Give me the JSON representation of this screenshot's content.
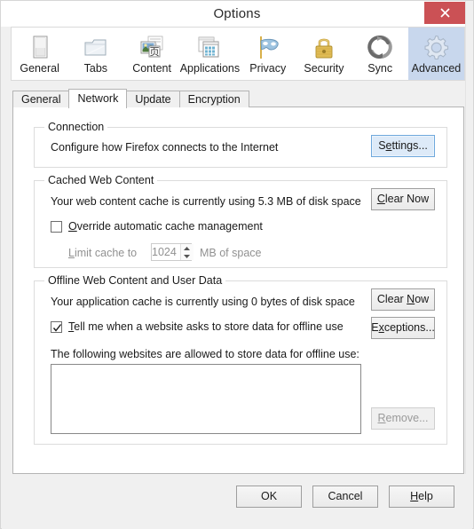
{
  "window": {
    "title": "Options",
    "close_label": "x",
    "close_icon": "close-icon"
  },
  "categories": [
    {
      "label": "General",
      "icon": "general-icon",
      "selected": false
    },
    {
      "label": "Tabs",
      "icon": "tabs-icon",
      "selected": false
    },
    {
      "label": "Content",
      "icon": "content-icon",
      "selected": false
    },
    {
      "label": "Applications",
      "icon": "applications-icon",
      "selected": false
    },
    {
      "label": "Privacy",
      "icon": "privacy-mask-icon",
      "selected": false
    },
    {
      "label": "Security",
      "icon": "padlock-icon",
      "selected": false
    },
    {
      "label": "Sync",
      "icon": "sync-arrows-icon",
      "selected": false
    },
    {
      "label": "Advanced",
      "icon": "gear-icon",
      "selected": true
    }
  ],
  "subtabs": [
    {
      "label": "General",
      "selected": false
    },
    {
      "label": "Network",
      "selected": true
    },
    {
      "label": "Update",
      "selected": false
    },
    {
      "label": "Encryption",
      "selected": false
    }
  ],
  "connection": {
    "group_title": "Connection",
    "description": "Configure how Firefox connects to the Internet",
    "settings_button": {
      "pre": "S",
      "accel": "e",
      "post": "ttings...",
      "focused": true
    }
  },
  "cache": {
    "group_title": "Cached Web Content",
    "usage_text": "Your web content cache is currently using 5.3 MB of disk space",
    "clear_button": {
      "pre": "",
      "accel": "C",
      "post": "lear Now"
    },
    "override_checkbox": {
      "checked": false,
      "pre": "",
      "accel": "O",
      "post": "verride automatic cache management"
    },
    "limit_label": {
      "pre": "",
      "accel": "L",
      "post": "imit cache to"
    },
    "limit_value": "1024",
    "limit_units": "MB of space",
    "disabled": true
  },
  "offline": {
    "group_title": "Offline Web Content and User Data",
    "usage_text": "Your application cache is currently using 0 bytes of disk space",
    "clear_button": {
      "pre": "Clear ",
      "accel": "N",
      "post": "ow"
    },
    "notify_checkbox": {
      "checked": true,
      "pre": "",
      "accel": "T",
      "post": "ell me when a website asks to store data for offline use"
    },
    "exceptions_button": {
      "pre": "E",
      "accel": "x",
      "post": "ceptions..."
    },
    "list_label": "The following websites are allowed to store data for offline use:",
    "list_items": [],
    "remove_button": {
      "pre": "",
      "accel": "R",
      "post": "emove...",
      "disabled": true
    }
  },
  "footer": {
    "ok": {
      "pre": "OK",
      "accel": "",
      "post": ""
    },
    "cancel": {
      "pre": "Cancel",
      "accel": "",
      "post": ""
    },
    "help": {
      "pre": "",
      "accel": "H",
      "post": "elp"
    }
  },
  "colors": {
    "selected_tab_bg": "#c8d7ed",
    "close_button_bg": "#cb5155",
    "focus_border": "#6fa8dc",
    "focus_fill": "#ddeaf8",
    "dialog_bg": "#f0f0f0",
    "panel_bg": "#ffffff",
    "disabled_text": "#919191"
  }
}
